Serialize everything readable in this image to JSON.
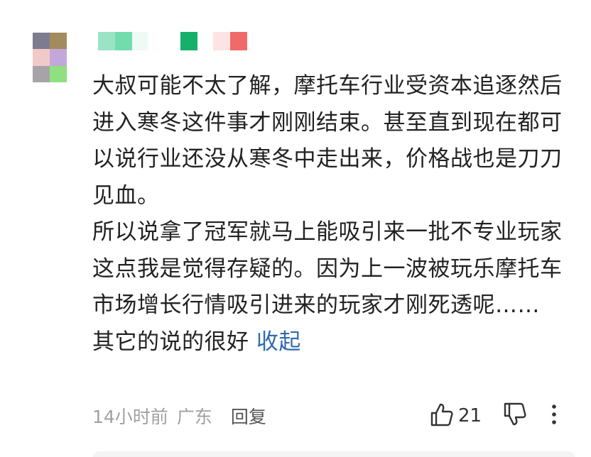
{
  "comment": {
    "lines": [
      "大叔可能不太了解，摩托车行业受资本追逐然后进入寒冬这件事才刚刚结束。甚至直到现在都可以说行业还没从寒冬中走出来，价格战也是刀刀见血。",
      "所以说拿了冠军就马上能吸引来一批不专业玩家这点我是觉得存疑的。因为上一波被玩乐摩托车市场增长行情吸引进来的玩家才刚死透呢……"
    ],
    "last_line": "其它的说的很好",
    "collapse_label": "收起"
  },
  "meta": {
    "time": "14小时前",
    "location": "广东",
    "reply_label": "回复"
  },
  "actions": {
    "like_count": "21",
    "like_icon": "thumbs-up-icon",
    "dislike_icon": "thumbs-down-icon",
    "more_icon": "more-vertical-icon"
  },
  "colors": {
    "accent_link": "#2f6bab",
    "meta_text": "#a0a0a0"
  }
}
